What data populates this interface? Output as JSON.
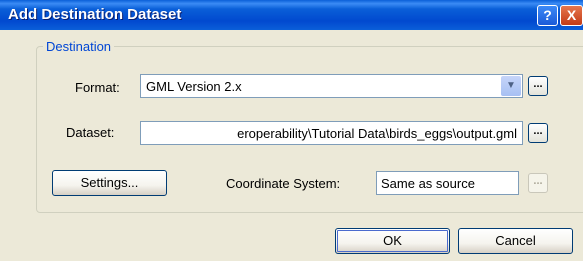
{
  "window": {
    "title": "Add Destination Dataset",
    "help_glyph": "?",
    "close_glyph": "X"
  },
  "destination": {
    "group_label": "Destination",
    "format_label": "Format:",
    "format_value": "GML Version 2.x",
    "dataset_label": "Dataset:",
    "dataset_value": "eroperability\\Tutorial Data\\birds_eggs\\output.gml",
    "browse_label": "...",
    "settings_label": "Settings...",
    "coordinate_label": "Coordinate System:",
    "coordinate_value": "Same as source"
  },
  "footer": {
    "ok_label": "OK",
    "cancel_label": "Cancel"
  },
  "icons": [
    "help-icon",
    "close-icon",
    "chevron-down-icon"
  ]
}
